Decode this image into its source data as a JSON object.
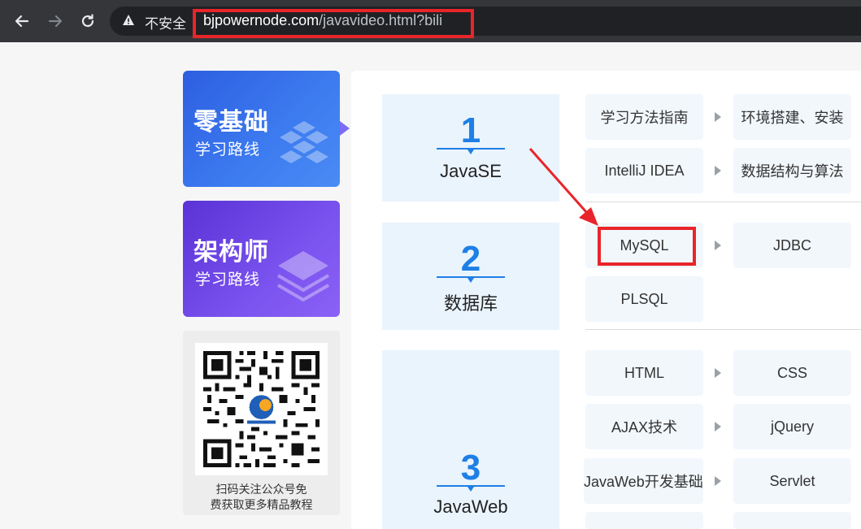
{
  "browser": {
    "back_icon": "arrow-left-icon",
    "forward_icon": "arrow-right-icon",
    "reload_icon": "reload-icon",
    "security_icon": "warning-icon",
    "security_label": "不安全",
    "url_host": "bjpowernode.com",
    "url_path": "/javavideo.html?bili"
  },
  "sidebar": {
    "cards": [
      {
        "title": "零基础",
        "subtitle": "学习路线"
      },
      {
        "title": "架构师",
        "subtitle": "学习路线"
      }
    ],
    "qr": {
      "caption_line1": "扫码关注公众号免",
      "caption_line2": "费获取更多精品教程"
    }
  },
  "sections": [
    {
      "number": "1",
      "name": "JavaSE",
      "topics": [
        "学习方法指南",
        "环境搭建、安装",
        "IntelliJ IDEA",
        "数据结构与算法"
      ]
    },
    {
      "number": "2",
      "name": "数据库",
      "topics": [
        "MySQL",
        "JDBC",
        "PLSQL"
      ]
    },
    {
      "number": "3",
      "name": "JavaWeb",
      "topics": [
        "HTML",
        "CSS",
        "AJAX技术",
        "jQuery",
        "JavaWeb开发基础",
        "Servlet"
      ]
    }
  ],
  "colors": {
    "annotation_red": "#e8252b",
    "accent_blue": "#1e7fe6"
  }
}
